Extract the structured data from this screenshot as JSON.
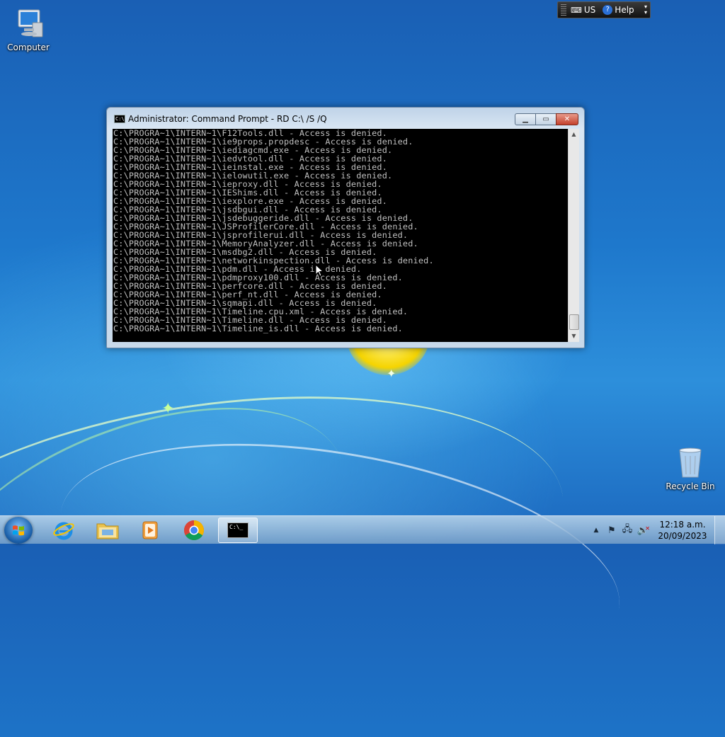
{
  "desktop": {
    "icons": [
      {
        "label": "Computer"
      },
      {
        "label": "Recycle Bin"
      }
    ]
  },
  "langbar": {
    "language": "US",
    "help": "Help"
  },
  "window": {
    "title": "Administrator:  Command Prompt - RD  C:\\ /S /Q",
    "lines": [
      "C:\\PROGRA~1\\INTERN~1\\F12Tools.dll - Access is denied.",
      "C:\\PROGRA~1\\INTERN~1\\ie9props.propdesc - Access is denied.",
      "C:\\PROGRA~1\\INTERN~1\\iediagcmd.exe - Access is denied.",
      "C:\\PROGRA~1\\INTERN~1\\iedvtool.dll - Access is denied.",
      "C:\\PROGRA~1\\INTERN~1\\ieinstal.exe - Access is denied.",
      "C:\\PROGRA~1\\INTERN~1\\ielowutil.exe - Access is denied.",
      "C:\\PROGRA~1\\INTERN~1\\ieproxy.dll - Access is denied.",
      "C:\\PROGRA~1\\INTERN~1\\IEShims.dll - Access is denied.",
      "C:\\PROGRA~1\\INTERN~1\\iexplore.exe - Access is denied.",
      "C:\\PROGRA~1\\INTERN~1\\jsdbgui.dll - Access is denied.",
      "C:\\PROGRA~1\\INTERN~1\\jsdebuggeride.dll - Access is denied.",
      "C:\\PROGRA~1\\INTERN~1\\JSProfilerCore.dll - Access is denied.",
      "C:\\PROGRA~1\\INTERN~1\\jsprofilerui.dll - Access is denied.",
      "C:\\PROGRA~1\\INTERN~1\\MemoryAnalyzer.dll - Access is denied.",
      "C:\\PROGRA~1\\INTERN~1\\msdbg2.dll - Access is denied.",
      "C:\\PROGRA~1\\INTERN~1\\networkinspection.dll - Access is denied.",
      "C:\\PROGRA~1\\INTERN~1\\pdm.dll - Access is denied.",
      "C:\\PROGRA~1\\INTERN~1\\pdmproxy100.dll - Access is denied.",
      "C:\\PROGRA~1\\INTERN~1\\perfcore.dll - Access is denied.",
      "C:\\PROGRA~1\\INTERN~1\\perf_nt.dll - Access is denied.",
      "C:\\PROGRA~1\\INTERN~1\\sqmapi.dll - Access is denied.",
      "C:\\PROGRA~1\\INTERN~1\\Timeline.cpu.xml - Access is denied.",
      "C:\\PROGRA~1\\INTERN~1\\Timeline.dll - Access is denied.",
      "C:\\PROGRA~1\\INTERN~1\\Timeline_is.dll - Access is denied."
    ],
    "colors": {
      "background": "#000000",
      "text": "#c0c0c0"
    }
  },
  "taskbar": {
    "pinned": [
      {
        "name": "internet-explorer"
      },
      {
        "name": "windows-explorer"
      },
      {
        "name": "media-player"
      },
      {
        "name": "chrome"
      },
      {
        "name": "command-prompt",
        "active": true
      }
    ],
    "cmd_icon_text": "C:\\_",
    "clock": {
      "time": "12:18 a.m.",
      "date": "20/09/2023"
    }
  }
}
